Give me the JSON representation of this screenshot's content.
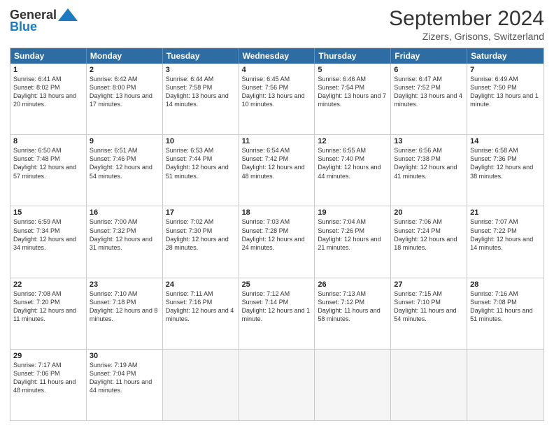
{
  "logo": {
    "general": "General",
    "blue": "Blue"
  },
  "title": "September 2024",
  "subtitle": "Zizers, Grisons, Switzerland",
  "days": [
    "Sunday",
    "Monday",
    "Tuesday",
    "Wednesday",
    "Thursday",
    "Friday",
    "Saturday"
  ],
  "weeks": [
    [
      {
        "day": "1",
        "sunrise": "Sunrise: 6:41 AM",
        "sunset": "Sunset: 8:02 PM",
        "daylight": "Daylight: 13 hours and 20 minutes."
      },
      {
        "day": "2",
        "sunrise": "Sunrise: 6:42 AM",
        "sunset": "Sunset: 8:00 PM",
        "daylight": "Daylight: 13 hours and 17 minutes."
      },
      {
        "day": "3",
        "sunrise": "Sunrise: 6:44 AM",
        "sunset": "Sunset: 7:58 PM",
        "daylight": "Daylight: 13 hours and 14 minutes."
      },
      {
        "day": "4",
        "sunrise": "Sunrise: 6:45 AM",
        "sunset": "Sunset: 7:56 PM",
        "daylight": "Daylight: 13 hours and 10 minutes."
      },
      {
        "day": "5",
        "sunrise": "Sunrise: 6:46 AM",
        "sunset": "Sunset: 7:54 PM",
        "daylight": "Daylight: 13 hours and 7 minutes."
      },
      {
        "day": "6",
        "sunrise": "Sunrise: 6:47 AM",
        "sunset": "Sunset: 7:52 PM",
        "daylight": "Daylight: 13 hours and 4 minutes."
      },
      {
        "day": "7",
        "sunrise": "Sunrise: 6:49 AM",
        "sunset": "Sunset: 7:50 PM",
        "daylight": "Daylight: 13 hours and 1 minute."
      }
    ],
    [
      {
        "day": "8",
        "sunrise": "Sunrise: 6:50 AM",
        "sunset": "Sunset: 7:48 PM",
        "daylight": "Daylight: 12 hours and 57 minutes."
      },
      {
        "day": "9",
        "sunrise": "Sunrise: 6:51 AM",
        "sunset": "Sunset: 7:46 PM",
        "daylight": "Daylight: 12 hours and 54 minutes."
      },
      {
        "day": "10",
        "sunrise": "Sunrise: 6:53 AM",
        "sunset": "Sunset: 7:44 PM",
        "daylight": "Daylight: 12 hours and 51 minutes."
      },
      {
        "day": "11",
        "sunrise": "Sunrise: 6:54 AM",
        "sunset": "Sunset: 7:42 PM",
        "daylight": "Daylight: 12 hours and 48 minutes."
      },
      {
        "day": "12",
        "sunrise": "Sunrise: 6:55 AM",
        "sunset": "Sunset: 7:40 PM",
        "daylight": "Daylight: 12 hours and 44 minutes."
      },
      {
        "day": "13",
        "sunrise": "Sunrise: 6:56 AM",
        "sunset": "Sunset: 7:38 PM",
        "daylight": "Daylight: 12 hours and 41 minutes."
      },
      {
        "day": "14",
        "sunrise": "Sunrise: 6:58 AM",
        "sunset": "Sunset: 7:36 PM",
        "daylight": "Daylight: 12 hours and 38 minutes."
      }
    ],
    [
      {
        "day": "15",
        "sunrise": "Sunrise: 6:59 AM",
        "sunset": "Sunset: 7:34 PM",
        "daylight": "Daylight: 12 hours and 34 minutes."
      },
      {
        "day": "16",
        "sunrise": "Sunrise: 7:00 AM",
        "sunset": "Sunset: 7:32 PM",
        "daylight": "Daylight: 12 hours and 31 minutes."
      },
      {
        "day": "17",
        "sunrise": "Sunrise: 7:02 AM",
        "sunset": "Sunset: 7:30 PM",
        "daylight": "Daylight: 12 hours and 28 minutes."
      },
      {
        "day": "18",
        "sunrise": "Sunrise: 7:03 AM",
        "sunset": "Sunset: 7:28 PM",
        "daylight": "Daylight: 12 hours and 24 minutes."
      },
      {
        "day": "19",
        "sunrise": "Sunrise: 7:04 AM",
        "sunset": "Sunset: 7:26 PM",
        "daylight": "Daylight: 12 hours and 21 minutes."
      },
      {
        "day": "20",
        "sunrise": "Sunrise: 7:06 AM",
        "sunset": "Sunset: 7:24 PM",
        "daylight": "Daylight: 12 hours and 18 minutes."
      },
      {
        "day": "21",
        "sunrise": "Sunrise: 7:07 AM",
        "sunset": "Sunset: 7:22 PM",
        "daylight": "Daylight: 12 hours and 14 minutes."
      }
    ],
    [
      {
        "day": "22",
        "sunrise": "Sunrise: 7:08 AM",
        "sunset": "Sunset: 7:20 PM",
        "daylight": "Daylight: 12 hours and 11 minutes."
      },
      {
        "day": "23",
        "sunrise": "Sunrise: 7:10 AM",
        "sunset": "Sunset: 7:18 PM",
        "daylight": "Daylight: 12 hours and 8 minutes."
      },
      {
        "day": "24",
        "sunrise": "Sunrise: 7:11 AM",
        "sunset": "Sunset: 7:16 PM",
        "daylight": "Daylight: 12 hours and 4 minutes."
      },
      {
        "day": "25",
        "sunrise": "Sunrise: 7:12 AM",
        "sunset": "Sunset: 7:14 PM",
        "daylight": "Daylight: 12 hours and 1 minute."
      },
      {
        "day": "26",
        "sunrise": "Sunrise: 7:13 AM",
        "sunset": "Sunset: 7:12 PM",
        "daylight": "Daylight: 11 hours and 58 minutes."
      },
      {
        "day": "27",
        "sunrise": "Sunrise: 7:15 AM",
        "sunset": "Sunset: 7:10 PM",
        "daylight": "Daylight: 11 hours and 54 minutes."
      },
      {
        "day": "28",
        "sunrise": "Sunrise: 7:16 AM",
        "sunset": "Sunset: 7:08 PM",
        "daylight": "Daylight: 11 hours and 51 minutes."
      }
    ],
    [
      {
        "day": "29",
        "sunrise": "Sunrise: 7:17 AM",
        "sunset": "Sunset: 7:06 PM",
        "daylight": "Daylight: 11 hours and 48 minutes."
      },
      {
        "day": "30",
        "sunrise": "Sunrise: 7:19 AM",
        "sunset": "Sunset: 7:04 PM",
        "daylight": "Daylight: 11 hours and 44 minutes."
      },
      {
        "day": "",
        "sunrise": "",
        "sunset": "",
        "daylight": ""
      },
      {
        "day": "",
        "sunrise": "",
        "sunset": "",
        "daylight": ""
      },
      {
        "day": "",
        "sunrise": "",
        "sunset": "",
        "daylight": ""
      },
      {
        "day": "",
        "sunrise": "",
        "sunset": "",
        "daylight": ""
      },
      {
        "day": "",
        "sunrise": "",
        "sunset": "",
        "daylight": ""
      }
    ]
  ]
}
